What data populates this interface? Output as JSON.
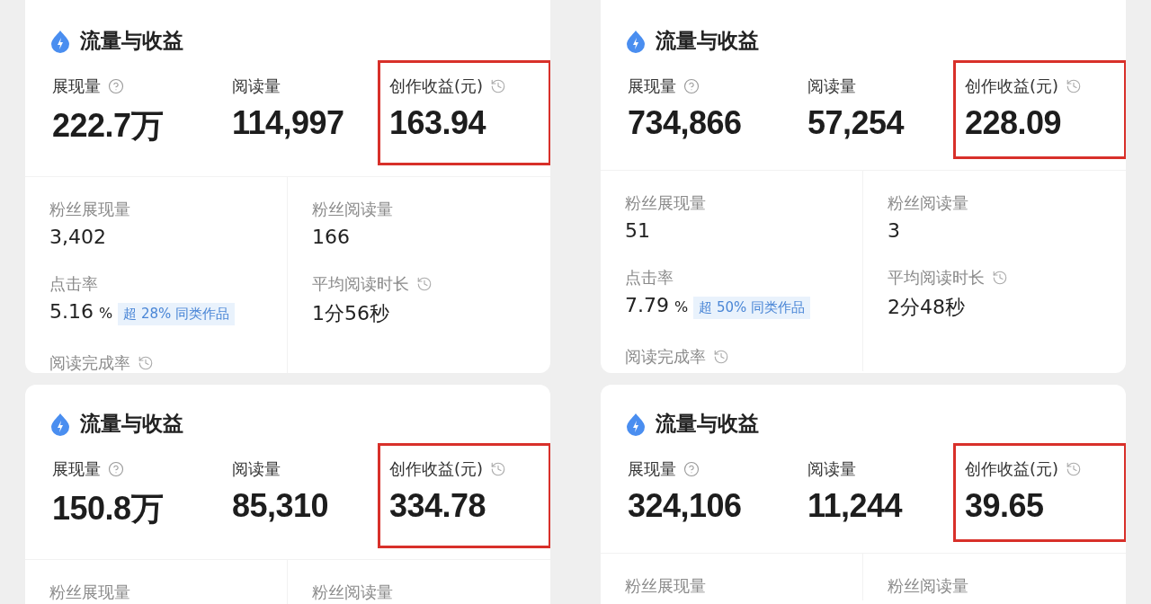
{
  "panels": [
    {
      "title": "流量与收益",
      "metrics": [
        {
          "label": "展现量",
          "kind": "with_help",
          "value": "222.7万",
          "highlighted": false
        },
        {
          "label": "阅读量",
          "kind": "plain",
          "value": "114,997",
          "highlighted": false
        },
        {
          "label": "创作收益(元)",
          "kind": "with_history",
          "value": "163.94",
          "highlighted": true
        }
      ],
      "sub_metrics": [
        {
          "label": "粉丝展现量",
          "kind": "plain",
          "value": "3,402"
        },
        {
          "label": "粉丝阅读量",
          "kind": "plain",
          "value": "166"
        },
        {
          "label": "点击率",
          "kind": "plain",
          "value": "5.16",
          "unit": "%",
          "badge": "超 28% 同类作品"
        },
        {
          "label": "平均阅读时长",
          "kind": "with_history",
          "value": "1分56秒"
        },
        {
          "label": "阅读完成率",
          "kind": "with_history"
        }
      ]
    },
    {
      "title": "流量与收益",
      "metrics": [
        {
          "label": "展现量",
          "kind": "with_help",
          "value": "734,866",
          "highlighted": false
        },
        {
          "label": "阅读量",
          "kind": "plain",
          "value": "57,254",
          "highlighted": false
        },
        {
          "label": "创作收益(元)",
          "kind": "with_history",
          "value": "228.09",
          "highlighted": true
        }
      ],
      "sub_metrics": [
        {
          "label": "粉丝展现量",
          "kind": "plain",
          "value": "51"
        },
        {
          "label": "粉丝阅读量",
          "kind": "plain",
          "value": "3"
        },
        {
          "label": "点击率",
          "kind": "plain",
          "value": "7.79",
          "unit": "%",
          "badge": "超 50% 同类作品"
        },
        {
          "label": "平均阅读时长",
          "kind": "with_history",
          "value": "2分48秒"
        },
        {
          "label": "阅读完成率",
          "kind": "with_history"
        }
      ]
    },
    {
      "title": "流量与收益",
      "metrics": [
        {
          "label": "展现量",
          "kind": "with_help",
          "value": "150.8万",
          "highlighted": false
        },
        {
          "label": "阅读量",
          "kind": "plain",
          "value": "85,310",
          "highlighted": false
        },
        {
          "label": "创作收益(元)",
          "kind": "with_history",
          "value": "334.78",
          "highlighted": true
        }
      ],
      "sub_metrics": [
        {
          "label": "粉丝展现量",
          "kind": "plain"
        },
        {
          "label": "粉丝阅读量",
          "kind": "plain"
        }
      ]
    },
    {
      "title": "流量与收益",
      "metrics": [
        {
          "label": "展现量",
          "kind": "with_help",
          "value": "324,106",
          "highlighted": false
        },
        {
          "label": "阅读量",
          "kind": "plain",
          "value": "11,244",
          "highlighted": false
        },
        {
          "label": "创作收益(元)",
          "kind": "with_history",
          "value": "39.65",
          "highlighted": true
        }
      ],
      "sub_metrics": [
        {
          "label": "粉丝展现量",
          "kind": "plain"
        },
        {
          "label": "粉丝阅读量",
          "kind": "plain"
        }
      ]
    }
  ]
}
